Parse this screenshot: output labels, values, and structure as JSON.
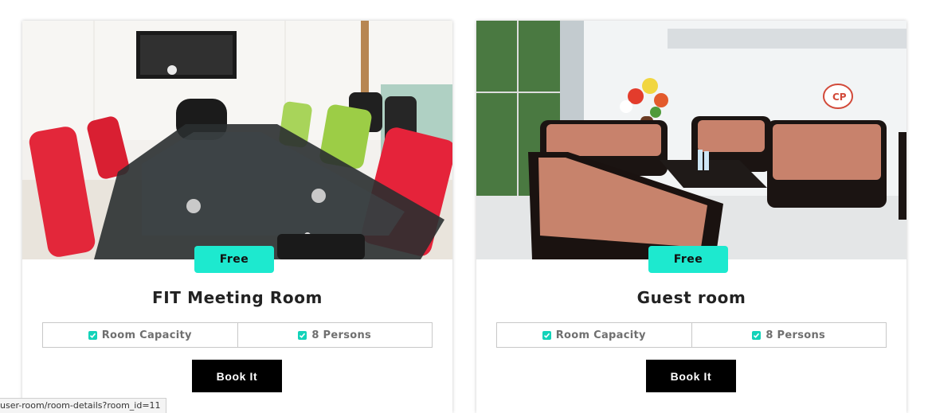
{
  "rooms": [
    {
      "price_label": "Free",
      "title": "FIT Meeting Room",
      "feature_label": "Room Capacity",
      "feature_value": "8 Persons",
      "button_label": "Book It",
      "photo": "conference-room-photo"
    },
    {
      "price_label": "Free",
      "title": "Guest room",
      "feature_label": "Room Capacity",
      "feature_value": "8 Persons",
      "button_label": "Book It",
      "photo": "lounge-sofa-photo"
    }
  ],
  "status_bar": {
    "url": "user-room/room-details?room_id=11"
  },
  "colors": {
    "badge": "#1de9cf",
    "check": "#12d3b9",
    "button": "#000000"
  }
}
